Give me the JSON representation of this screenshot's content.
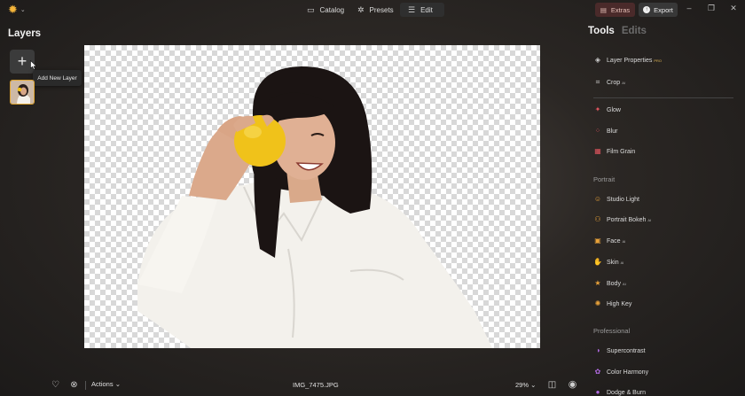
{
  "topbar": {
    "tabs": [
      {
        "label": "Catalog",
        "icon": "folder-icon"
      },
      {
        "label": "Presets",
        "icon": "sparkle-icon"
      },
      {
        "label": "Edit",
        "icon": "sliders-icon"
      }
    ],
    "extras_label": "Extras",
    "export_label": "Export"
  },
  "layers": {
    "title": "Layers",
    "tooltip": "Add New Layer"
  },
  "bottom": {
    "actions_label": "Actions",
    "filename": "IMG_7475.JPG",
    "zoom": "29%"
  },
  "right": {
    "tab_tools": "Tools",
    "tab_edits": "Edits",
    "top_items": [
      {
        "label": "Layer Properties",
        "badge": "PRO"
      },
      {
        "label": "Crop",
        "badge": "AI"
      }
    ],
    "creative_items": [
      {
        "label": "Glow"
      },
      {
        "label": "Blur"
      },
      {
        "label": "Film Grain"
      }
    ],
    "portrait_head": "Portrait",
    "portrait_items": [
      {
        "label": "Studio Light",
        "badge": ""
      },
      {
        "label": "Portrait Bokeh",
        "badge": "AI"
      },
      {
        "label": "Face",
        "badge": "AI"
      },
      {
        "label": "Skin",
        "badge": "AI"
      },
      {
        "label": "Body",
        "badge": "AI"
      },
      {
        "label": "High Key",
        "badge": ""
      }
    ],
    "professional_head": "Professional",
    "professional_items": [
      {
        "label": "Supercontrast"
      },
      {
        "label": "Color Harmony"
      },
      {
        "label": "Dodge & Burn"
      }
    ]
  },
  "colors": {
    "accent": "#e0a52e",
    "extras_bg": "#4a2a2a"
  }
}
